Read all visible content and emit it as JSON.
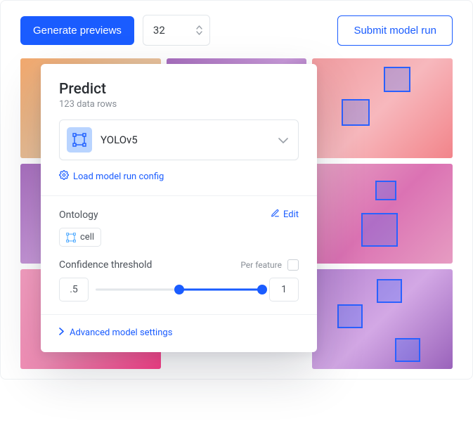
{
  "topbar": {
    "generate_label": "Generate previews",
    "count_value": "32",
    "submit_label": "Submit model run"
  },
  "card": {
    "title": "Predict",
    "subtitle": "123 data rows",
    "model_name": "YOLOv5",
    "load_config_label": "Load model run config",
    "ontology_label": "Ontology",
    "edit_label": "Edit",
    "chip_label": "cell",
    "confidence_label": "Confidence threshold",
    "per_feature_label": "Per feature",
    "conf_min": ".5",
    "conf_max": "1",
    "advanced_label": "Advanced model settings"
  }
}
